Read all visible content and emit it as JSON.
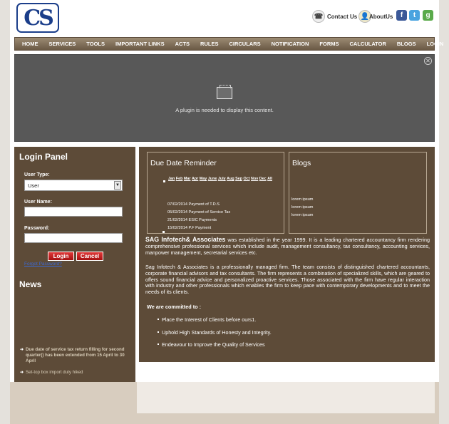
{
  "header": {
    "logo_text": "CS",
    "contact_label": "Contact Us",
    "about_label": "AboutUs",
    "social": [
      {
        "name": "facebook",
        "glyph": "f",
        "color": "#3b5998"
      },
      {
        "name": "twitter",
        "glyph": "t",
        "color": "#4aa3df"
      },
      {
        "name": "google",
        "glyph": "g",
        "color": "#5aaa4a"
      }
    ]
  },
  "nav": [
    "HOME",
    "SERVICES",
    "TOOLS",
    "IMPORTANT LINKS",
    "ACTS",
    "RULES",
    "CIRCULARS",
    "NOTIFICATION",
    "FORMS",
    "CALCULATOR",
    "BLOGS",
    "LOGIN"
  ],
  "plugin": {
    "message": "A plugin is needed to display this content."
  },
  "login": {
    "title": "Login Panel",
    "user_type_label": "User Type:",
    "user_type_value": "User",
    "user_name_label": "User Name:",
    "password_label": "Password:",
    "login_button": "Login",
    "cancel_button": "Cancel",
    "forgot_link": "Forgot Password?"
  },
  "news": {
    "title": "News",
    "items": [
      {
        "before": "Due date of service tax return filling for second quarter(",
        "highlight": "",
        "after": ") has been extended from 15 April to 30 April"
      },
      {
        "before": "Set-top box import duty hiked",
        "highlight": "",
        "after": ""
      }
    ]
  },
  "due_reminder": {
    "title": "Due Date Reminder",
    "months": [
      "Jan",
      "Feb",
      "Mar",
      "Apr",
      "May",
      "June",
      "July",
      "Aug",
      "Sep",
      "Oct",
      "Nov",
      "Dec",
      "All"
    ],
    "items": [
      "07/02/2014 Payment of T.D.S",
      "05/02/2014 Payment of Service Tax",
      "21/02/2014 ESIC Payments",
      "15/02/2014 P.F Payment"
    ]
  },
  "blogs": {
    "title": "Blogs",
    "items": [
      "lorem ipsum",
      "lorem ipsum",
      "lorem ipsum"
    ]
  },
  "about": {
    "company": "SAG Infotech& Associates",
    "para1": " was established in the year 1999. It is a leading chartered accountancy firm rendering comprehensive professional services which include audit, management consultancy, tax consultancy, accounting services, manpower management, secretarial services etc.",
    "para2": "Sag Infotech & Associates is a professionally managed firm. The team consists of distinguished chartered accountants, corporate financial advisors and tax consultants. The firm represents a combination of specialized skills, which are geared to offers sound financial advice and personalized proactive services. Those associated with the firm have regular interaction with industry and other professionals which enables the firm to keep pace with contemporary developments and to meet the needs of its clients.",
    "committed_title": "We are committed to :",
    "commitments": [
      "Place the Interest of Clients before ours1.",
      "Uphold High Standards of Honesty and Integrity.",
      "Endeavour to Improve the Quality of Services"
    ]
  }
}
